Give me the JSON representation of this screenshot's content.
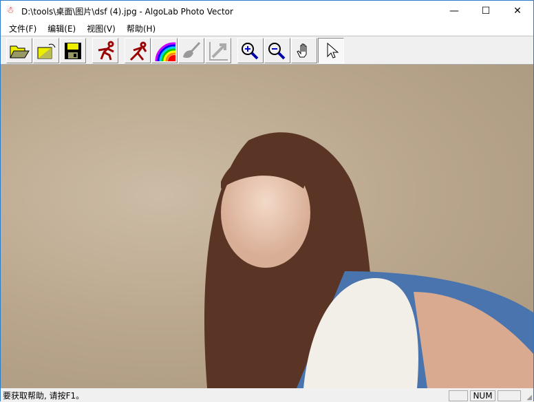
{
  "window": {
    "title": "D:\\tools\\桌面\\图片\\dsf (4).jpg - AlgoLab Photo Vector",
    "minimize": "—",
    "maximize": "☐",
    "close": "✕"
  },
  "menu": [
    "文件(F)",
    "编辑(E)",
    "视图(V)",
    "帮助(H)"
  ],
  "toolbar": [
    {
      "name": "open-icon",
      "tip": "open"
    },
    {
      "name": "open-as-icon",
      "tip": "import"
    },
    {
      "name": "save-icon",
      "tip": "save"
    },
    {
      "name": "run-icon",
      "tip": "vectorize"
    },
    {
      "name": "run-alt-icon",
      "tip": "vectorize alt"
    },
    {
      "name": "rainbow-icon",
      "tip": "colors"
    },
    {
      "name": "broom-icon",
      "tip": "clean"
    },
    {
      "name": "resize-icon",
      "tip": "resize"
    },
    {
      "name": "zoom-in-icon",
      "tip": "zoom in"
    },
    {
      "name": "zoom-out-icon",
      "tip": "zoom out"
    },
    {
      "name": "hand-icon",
      "tip": "pan"
    },
    {
      "name": "pointer-icon",
      "tip": "select"
    }
  ],
  "status": {
    "text": "要获取帮助, 请按F1。",
    "num": "NUM"
  },
  "colors": {
    "accent": "#2b79c7"
  }
}
